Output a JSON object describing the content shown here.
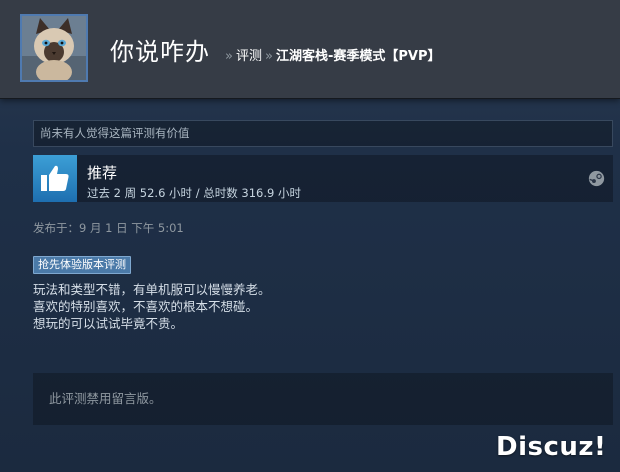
{
  "header": {
    "persona_name": "你说咋办",
    "breadcrumb_sep": "»",
    "breadcrumb_reviews": "评测",
    "game_title": "江湖客栈-赛季模式【PVP】"
  },
  "helpful_text": "尚未有人觉得这篇评测有价值",
  "recommendation": {
    "title": "推荐",
    "hours": "过去 2 周 52.6 小时 / 总时数 316.9 小时"
  },
  "posted": "发布于：9 月 1 日 下午 5:01",
  "early_access_badge": "抢先体验版本评测",
  "review_lines": [
    "玩法和类型不错，有单机服可以慢慢养老。",
    "喜欢的特别喜欢，不喜欢的根本不想碰。",
    "想玩的可以试试毕竟不贵。"
  ],
  "comments_disabled": "此评测禁用留言版。",
  "watermark": "Discuz!",
  "colors": {
    "header_bg": "#363c46",
    "thumb_blue": "#3c9fd6",
    "badge_bg": "#4b7aa8"
  },
  "icons": {
    "thumb": "thumbs-up-icon",
    "steam": "steam-logo-icon"
  }
}
